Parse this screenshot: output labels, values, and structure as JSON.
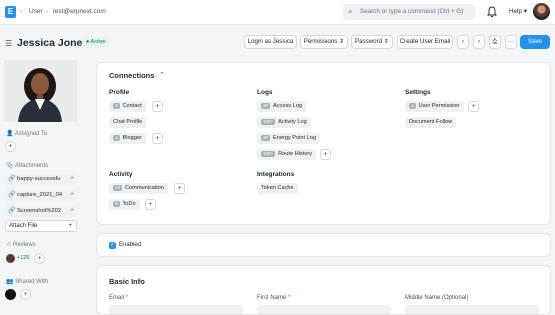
{
  "nav": {
    "logo": "E",
    "crumb1": "User",
    "crumb2": "test@erpnext.com",
    "search_placeholder": "Search or type a command (Ctrl + G)",
    "help": "Help"
  },
  "header": {
    "title": "Jessica Jones",
    "status": "Active",
    "actions": {
      "login_as": "Login as Jessica",
      "permissions": "Permissions",
      "password": "Password",
      "create_email": "Create User Email",
      "more": "···",
      "save": "Save"
    }
  },
  "sidebar": {
    "assigned_to": "Assigned To",
    "attachments": "Attachments",
    "files": [
      "happy-successfu",
      "capture_2021_04",
      "Screenshot%202"
    ],
    "attach_file": "Attach File",
    "reviews": "Reviews",
    "review_count": "+125",
    "shared_with": "Shared With"
  },
  "connections": {
    "title": "Connections",
    "groups": [
      {
        "name": "Profile",
        "items": [
          {
            "count": "0",
            "label": "Contact"
          },
          {
            "count": "",
            "label": "Chat Profile"
          },
          {
            "count": "1",
            "label": "Blogger"
          }
        ]
      },
      {
        "name": "Logs",
        "items": [
          {
            "count": "20",
            "label": "Access Log"
          },
          {
            "count": "100+",
            "label": "Activity Log"
          },
          {
            "count": "20",
            "label": "Energy Point Log"
          },
          {
            "count": "100+",
            "label": "Route History"
          }
        ]
      },
      {
        "name": "Settings",
        "items": [
          {
            "count": "1",
            "label": "User Permission"
          },
          {
            "count": "",
            "label": "Document Follow"
          }
        ]
      },
      {
        "name": "Activity",
        "items": [
          {
            "count": "23",
            "label": "Communication"
          },
          {
            "count": "0",
            "label": "ToDo"
          }
        ]
      },
      {
        "name": "Integrations",
        "items": [
          {
            "count": "",
            "label": "Token Cache"
          }
        ]
      }
    ]
  },
  "enabled": {
    "label": "Enabled",
    "checked": true
  },
  "basic_info": {
    "title": "Basic Info",
    "email_label": "Email",
    "first_name_label": "First Name",
    "middle_name_label": "Middle Name (Optional)",
    "required_mark": "*"
  }
}
